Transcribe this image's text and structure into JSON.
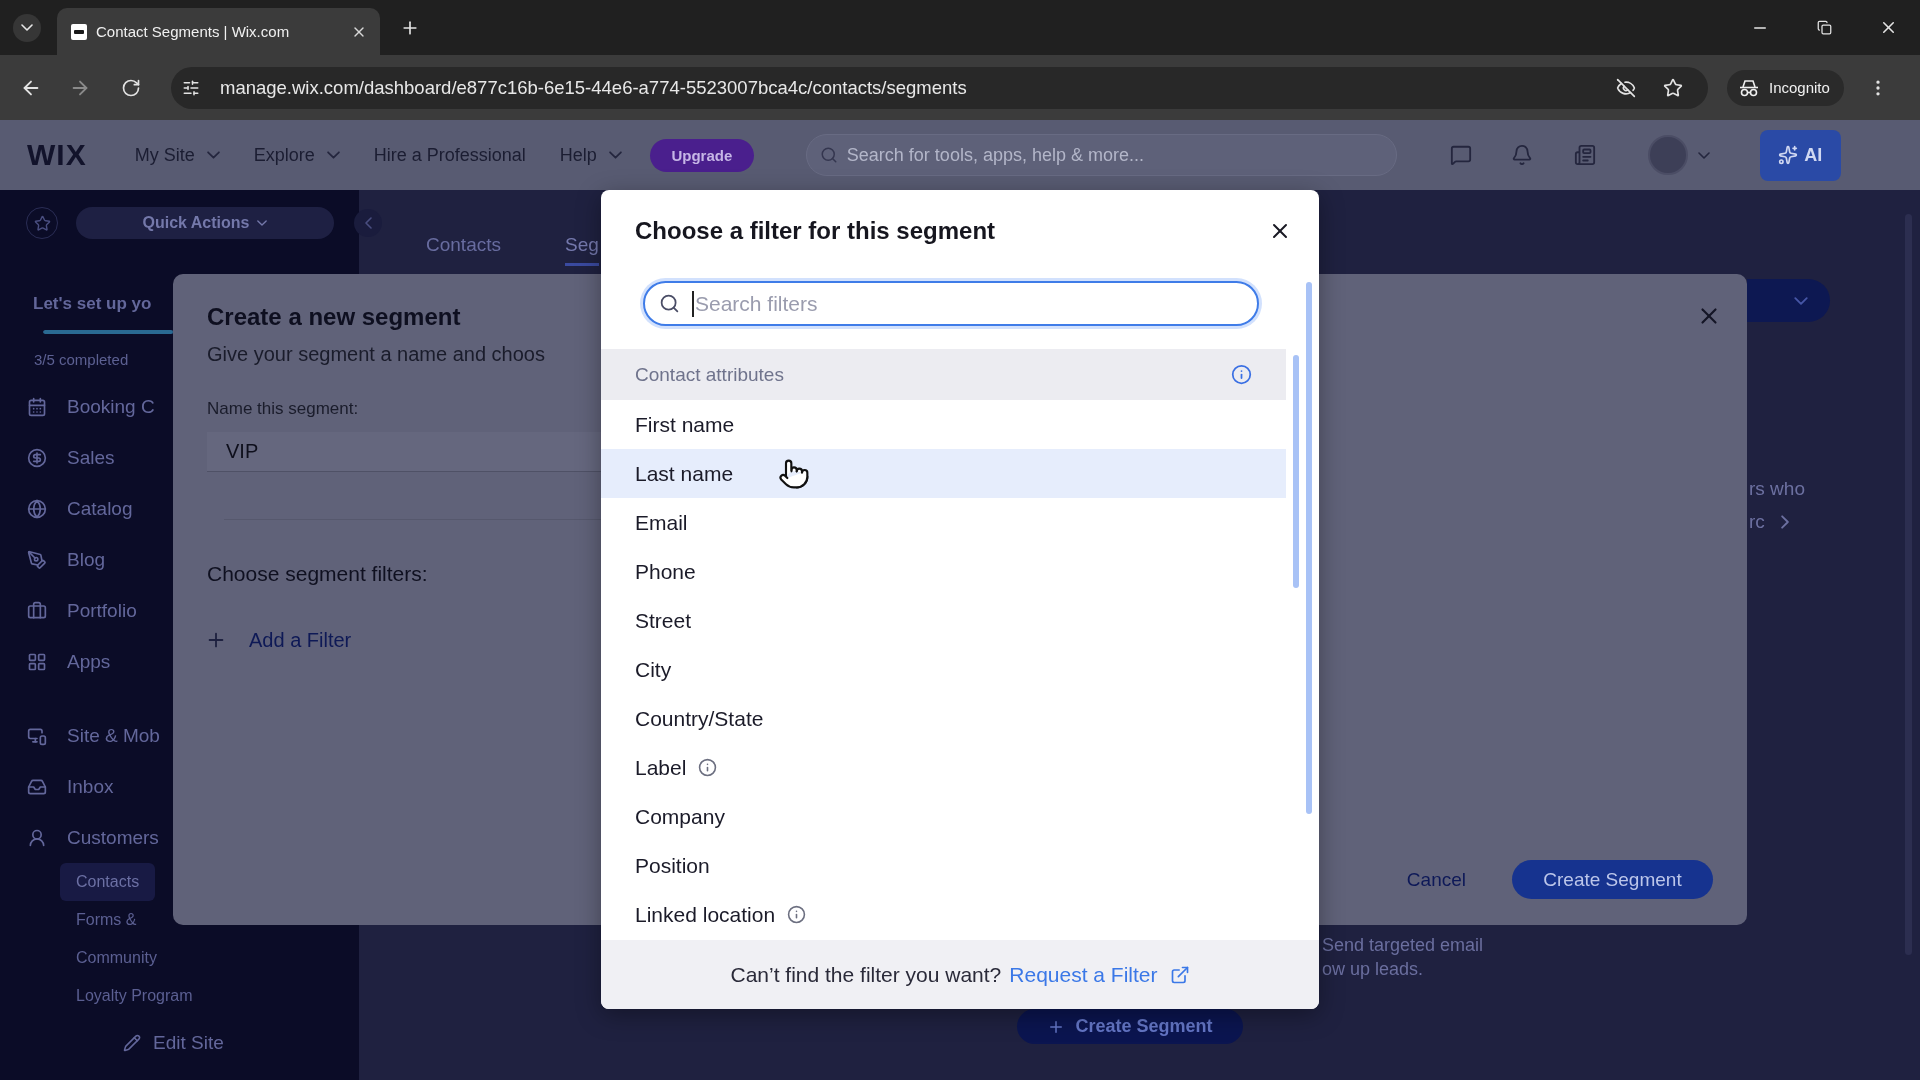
{
  "browser": {
    "tab_title": "Contact Segments | Wix.com",
    "url": "manage.wix.com/dashboard/e877c16b-6e15-44e6-a774-5523007bca4c/contacts/segments",
    "profile": "Incognito"
  },
  "header": {
    "logo": "WIX",
    "menus": [
      {
        "label": "My Site",
        "dropdown": true
      },
      {
        "label": "Explore",
        "dropdown": true
      },
      {
        "label": "Hire a Professional",
        "dropdown": false
      },
      {
        "label": "Help",
        "dropdown": true
      }
    ],
    "upgrade": "Upgrade",
    "search": {
      "placeholder": "Search for tools, apps, help & more..."
    },
    "ai": "AI"
  },
  "sidebar": {
    "quick_actions": "Quick Actions",
    "setup": {
      "title": "Let's set up yo",
      "level": 0.6,
      "progress": "3/5 completed"
    },
    "sections": [
      {
        "items": [
          {
            "label": "Booking C"
          },
          {
            "label": "Sales"
          },
          {
            "label": "Catalog"
          },
          {
            "label": "Blog"
          },
          {
            "label": "Portfolio"
          },
          {
            "label": "Apps"
          }
        ]
      },
      {
        "items": [
          {
            "label": "Site & Mob"
          },
          {
            "label": "Inbox"
          },
          {
            "label": "Customers",
            "children": [
              {
                "label": "Contacts",
                "selected": true
              },
              {
                "label": "Forms &",
                "selected": false
              },
              {
                "label": "Community",
                "selected": false
              },
              {
                "label": "Loyalty Program",
                "selected": false
              }
            ]
          }
        ]
      }
    ],
    "edit_site": "Edit Site"
  },
  "main": {
    "tabs": [
      {
        "label": "Contacts",
        "selected": false
      },
      {
        "label": "Seg",
        "selected": true
      }
    ],
    "card_lines": [
      "rs who",
      "rc"
    ],
    "empty_state": {
      "lines": [
        "Send targeted email",
        "ow up leads."
      ],
      "button": "Create Segment"
    }
  },
  "segment_modal": {
    "title": "Create a new segment",
    "subtitle": "Give your segment a name and choos",
    "name_label": "Name this segment:",
    "name_value": "VIP",
    "filters_label": "Choose segment filters:",
    "add_filter": "Add a Filter",
    "cancel": "Cancel",
    "submit": "Create Segment"
  },
  "filter_dialog": {
    "title": "Choose a filter for this segment",
    "search": {
      "placeholder": "Search filters",
      "focused": true
    },
    "group": "Contact attributes",
    "options": [
      {
        "label": "First name",
        "highlighted": false,
        "info": false
      },
      {
        "label": "Last name",
        "highlighted": true,
        "info": false
      },
      {
        "label": "Email",
        "highlighted": false,
        "info": false
      },
      {
        "label": "Phone",
        "highlighted": false,
        "info": false
      },
      {
        "label": "Street",
        "highlighted": false,
        "info": false
      },
      {
        "label": "City",
        "highlighted": false,
        "info": false
      },
      {
        "label": "Country/State",
        "highlighted": false,
        "info": false
      },
      {
        "label": "Label",
        "highlighted": false,
        "info": true
      },
      {
        "label": "Company",
        "highlighted": false,
        "info": false
      },
      {
        "label": "Position",
        "highlighted": false,
        "info": false
      },
      {
        "label": "Linked location",
        "highlighted": false,
        "info": true
      }
    ],
    "footer_text": "Can’t find the filter you want?",
    "footer_link": "Request a Filter"
  }
}
